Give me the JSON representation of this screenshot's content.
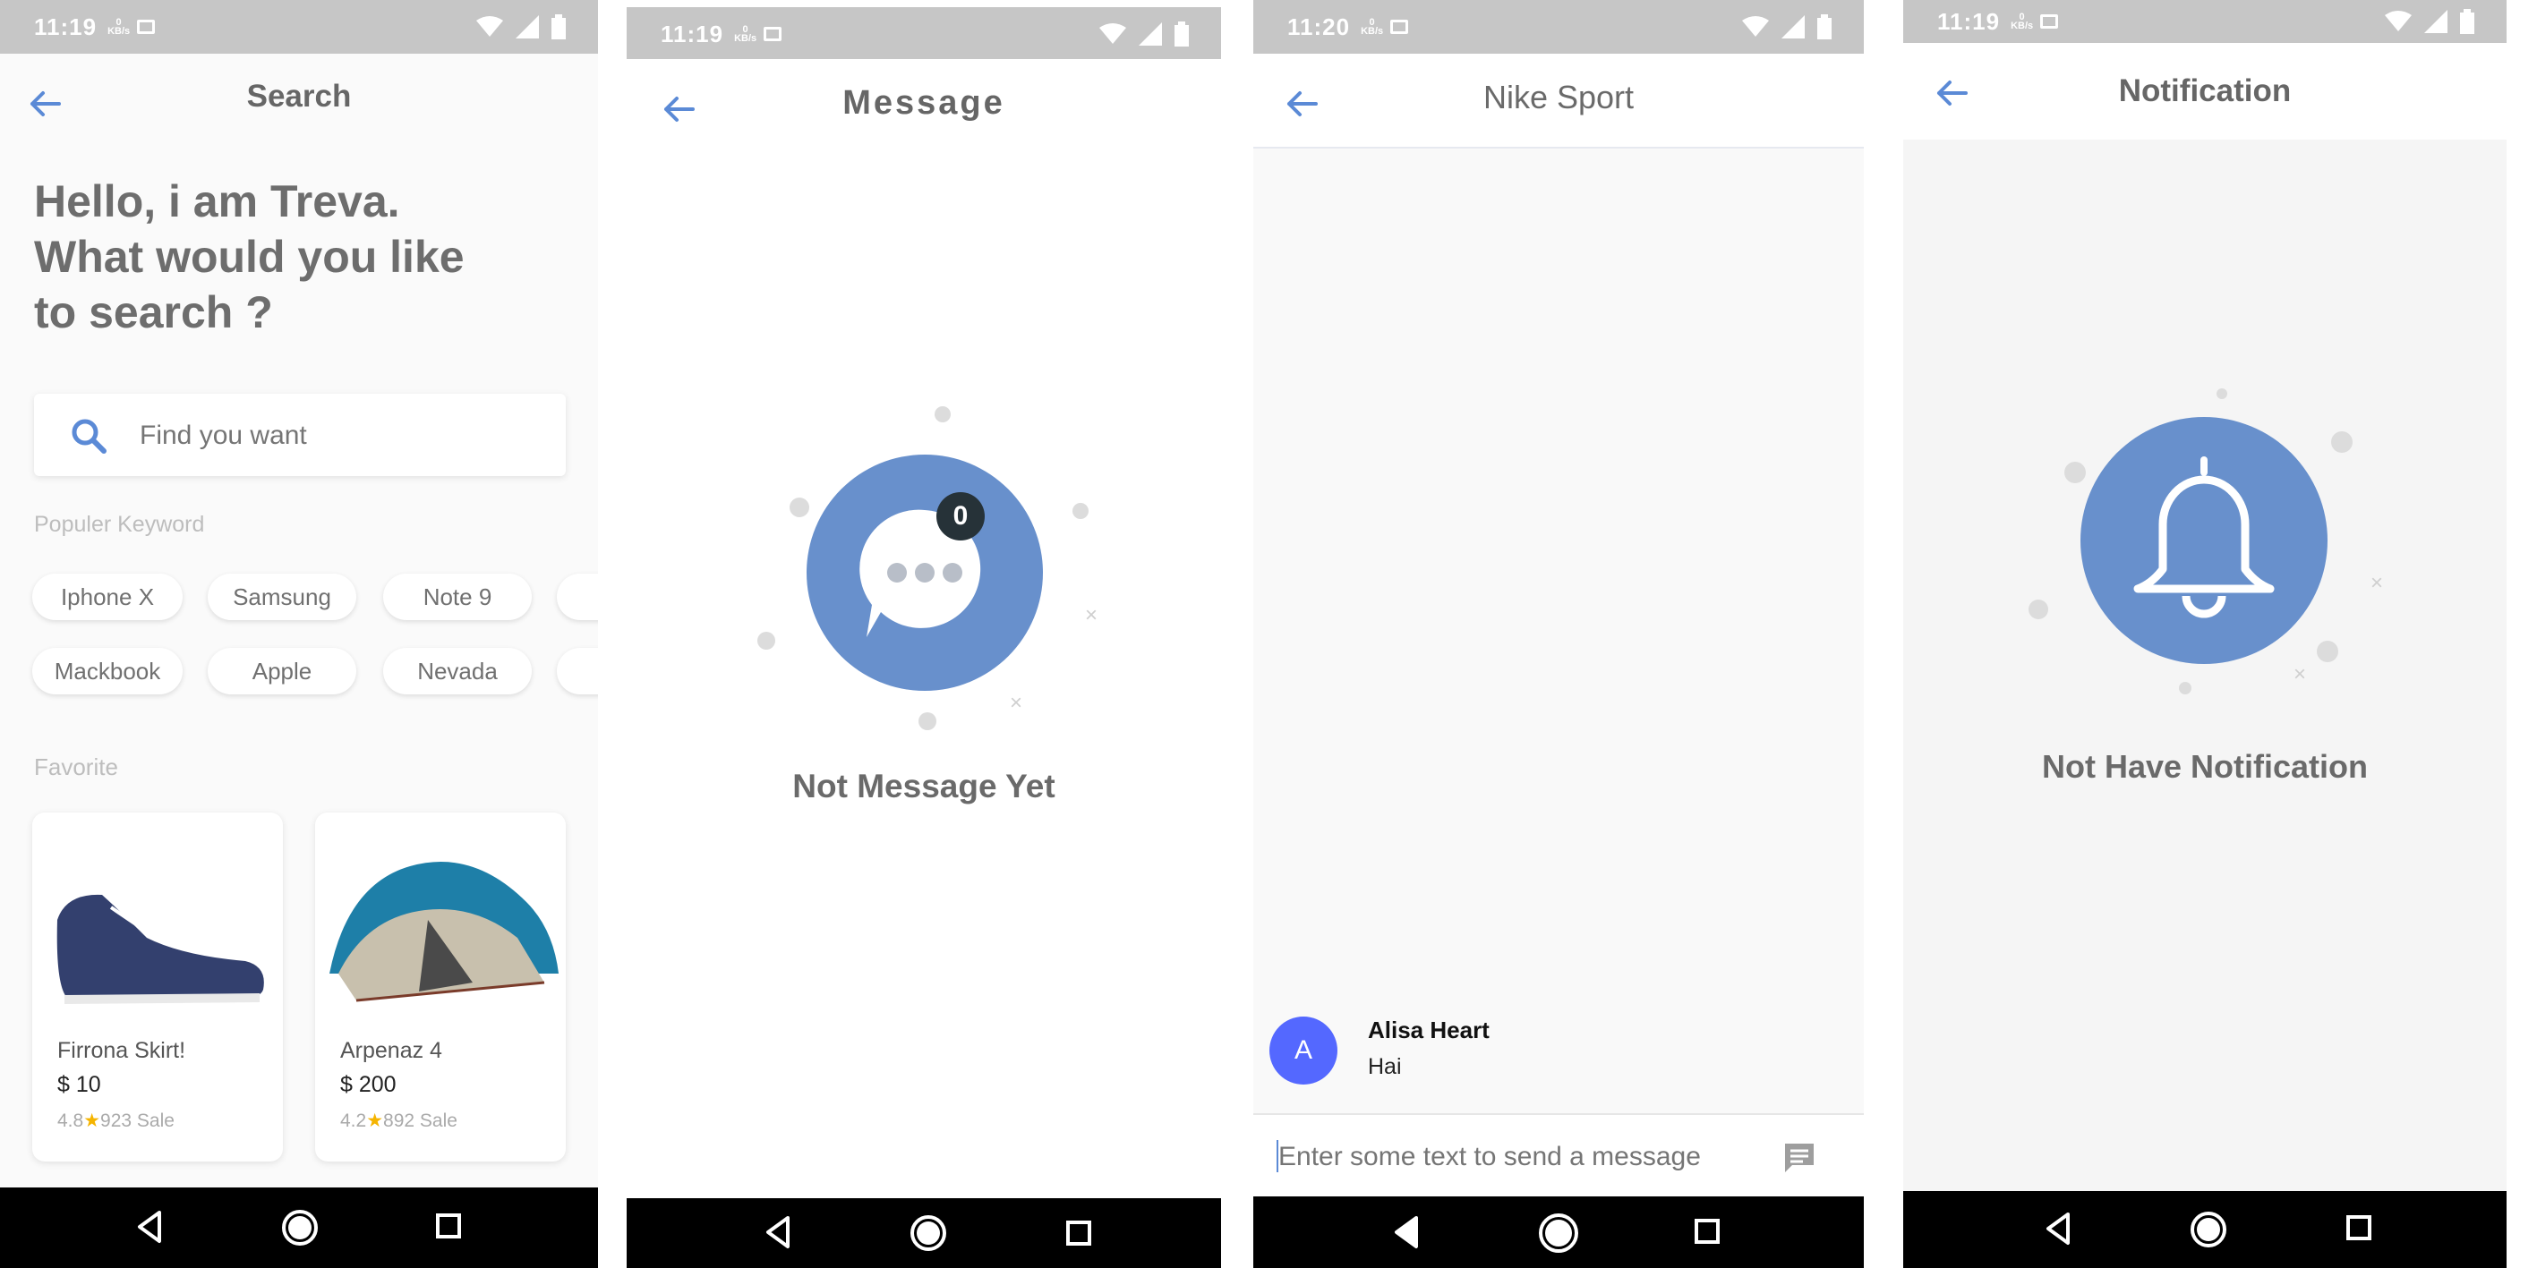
{
  "status_bar": {
    "time_1": "11:19",
    "time_2": "11:19",
    "time_3": "11:20",
    "time_4": "11:19",
    "speed_value": "0",
    "speed_unit": "KB/s"
  },
  "search_screen": {
    "title": "Search",
    "greeting_line1": "Hello, i am Treva.",
    "greeting_line2": "What would you like",
    "greeting_line3": "to search ?",
    "search_placeholder": "Find you want",
    "popular_heading": "Populer Keyword",
    "keywords_row1": [
      "Iphone X",
      "Samsung",
      "Note 9"
    ],
    "keywords_row2": [
      "Mackbook",
      "Apple",
      "Nevada"
    ],
    "favorite_heading": "Favorite",
    "products": [
      {
        "name": "Firrona Skirt!",
        "price": "$ 10",
        "rating": "4.8",
        "sales": "923 Sale"
      },
      {
        "name": "Arpenaz 4",
        "price": "$ 200",
        "rating": "4.2",
        "sales": "892 Sale"
      }
    ]
  },
  "message_screen": {
    "title": "Message",
    "badge_count": "0",
    "empty_text": "Not Message Yet"
  },
  "chat_screen": {
    "title": "Nike Sport",
    "message": {
      "avatar_letter": "A",
      "sender": "Alisa Heart",
      "text": "Hai"
    },
    "input_placeholder": "Enter some text to send a message"
  },
  "notification_screen": {
    "title": "Notification",
    "empty_text": "Not Have Notification"
  },
  "colors": {
    "accent": "#6890cc",
    "avatar": "#5468ff",
    "badge": "#263238",
    "text_gray": "#707070",
    "star": "#f5b400"
  }
}
